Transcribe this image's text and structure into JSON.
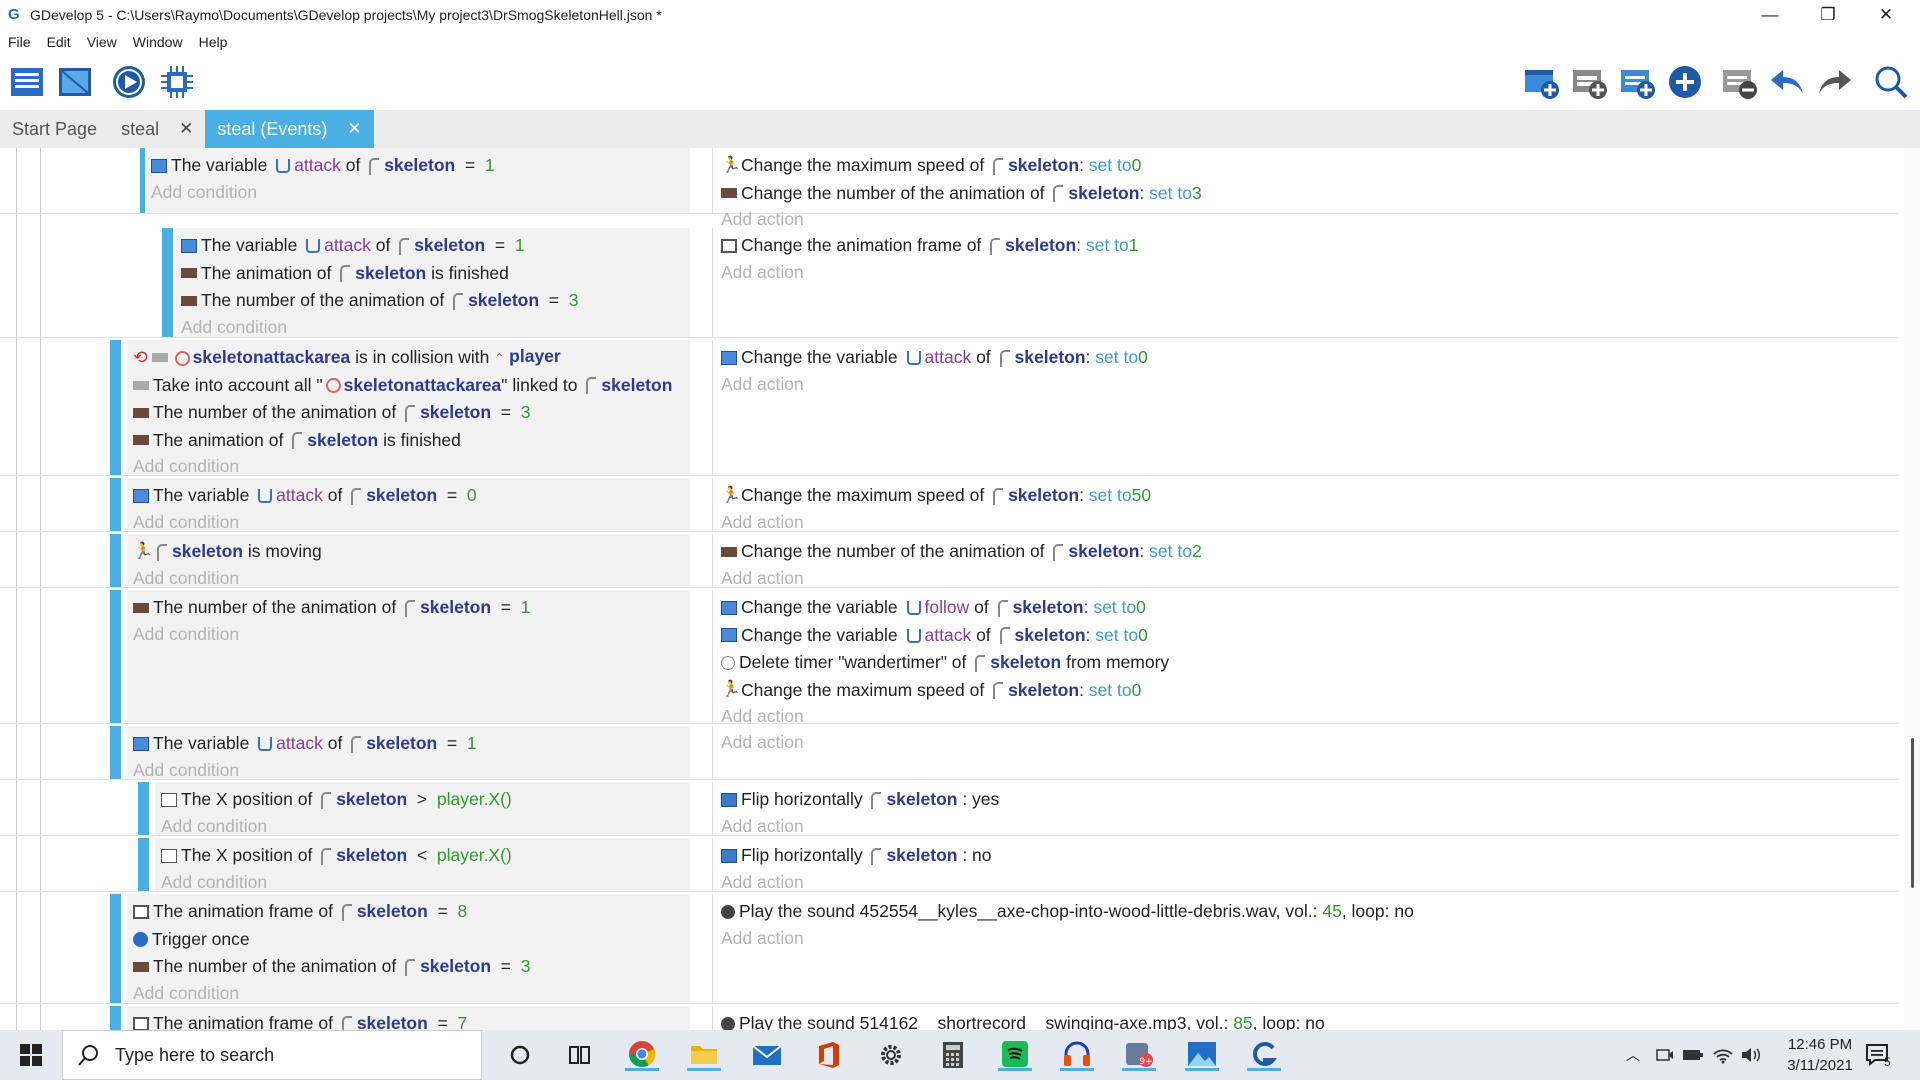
{
  "window": {
    "title": "GDevelop 5 - C:\\Users\\Raymo\\Documents\\GDevelop projects\\My project3\\DrSmogSkeletonHell.json *",
    "minimize": "—",
    "maximize": "❐",
    "close": "✕"
  },
  "menu": [
    "File",
    "Edit",
    "View",
    "Window",
    "Help"
  ],
  "tabs": [
    {
      "label": "Start Page",
      "active": false,
      "closable": false
    },
    {
      "label": "steal",
      "active": false,
      "closable": true
    },
    {
      "label": "steal (Events)",
      "active": true,
      "closable": true
    }
  ],
  "tab_close": "✕",
  "add_condition": "Add condition",
  "add_action": "Add action",
  "events": [
    {
      "conditions": [
        {
          "icon": "variable",
          "parts": [
            [
              "t",
              "The variable "
            ],
            [
              "v",
              "attack"
            ],
            [
              "t",
              " of "
            ],
            [
              "o",
              "skeleton"
            ],
            [
              "t",
              "  =  "
            ],
            [
              "n",
              "1"
            ]
          ]
        }
      ],
      "actions": [
        {
          "icon": "speed",
          "parts": [
            [
              "t",
              "Change the maximum speed of "
            ],
            [
              "o",
              "skeleton"
            ],
            [
              "t",
              ": "
            ],
            [
              "k",
              "set to "
            ],
            [
              "n",
              "0"
            ]
          ]
        },
        {
          "icon": "anim",
          "parts": [
            [
              "t",
              "Change the number of the animation of "
            ],
            [
              "o",
              "skeleton"
            ],
            [
              "t",
              ": "
            ],
            [
              "k",
              "set to "
            ],
            [
              "n",
              "3"
            ]
          ]
        }
      ]
    },
    {
      "conditions": [
        {
          "icon": "variable",
          "parts": [
            [
              "t",
              "The variable "
            ],
            [
              "v",
              "attack"
            ],
            [
              "t",
              " of "
            ],
            [
              "o",
              "skeleton"
            ],
            [
              "t",
              "  =  "
            ],
            [
              "n",
              "1"
            ]
          ]
        },
        {
          "icon": "anim",
          "parts": [
            [
              "t",
              "The animation of "
            ],
            [
              "o",
              "skeleton"
            ],
            [
              "t",
              " is finished"
            ]
          ]
        },
        {
          "icon": "anim",
          "parts": [
            [
              "t",
              "The number of the animation of "
            ],
            [
              "o",
              "skeleton"
            ],
            [
              "t",
              "  =  "
            ],
            [
              "n",
              "3"
            ]
          ]
        }
      ],
      "actions": [
        {
          "icon": "frame",
          "parts": [
            [
              "t",
              "Change the animation frame of "
            ],
            [
              "o",
              "skeleton"
            ],
            [
              "t",
              ": "
            ],
            [
              "k",
              "set to "
            ],
            [
              "n",
              "1"
            ]
          ]
        }
      ]
    },
    {
      "conditions": [
        {
          "icon": "collision",
          "parts": [
            [
              "c",
              "skeletonattackarea"
            ],
            [
              "t",
              " is in collision with "
            ],
            [
              "p",
              "player"
            ]
          ]
        },
        {
          "icon": "link",
          "parts": [
            [
              "t",
              "Take into account all \""
            ],
            [
              "c",
              "skeletonattackarea"
            ],
            [
              "t",
              "\" linked to "
            ],
            [
              "o",
              "skeleton"
            ]
          ]
        },
        {
          "icon": "anim",
          "parts": [
            [
              "t",
              "The number of the animation of "
            ],
            [
              "o",
              "skeleton"
            ],
            [
              "t",
              "  =  "
            ],
            [
              "n",
              "3"
            ]
          ]
        },
        {
          "icon": "anim",
          "parts": [
            [
              "t",
              "The animation of "
            ],
            [
              "o",
              "skeleton"
            ],
            [
              "t",
              " is finished"
            ]
          ]
        }
      ],
      "actions": [
        {
          "icon": "variable",
          "parts": [
            [
              "t",
              "Change the variable "
            ],
            [
              "v",
              "attack"
            ],
            [
              "t",
              " of "
            ],
            [
              "o",
              "skeleton"
            ],
            [
              "t",
              ": "
            ],
            [
              "k",
              "set to "
            ],
            [
              "n",
              "0"
            ]
          ]
        }
      ]
    },
    {
      "conditions": [
        {
          "icon": "variable",
          "parts": [
            [
              "t",
              "The variable "
            ],
            [
              "v",
              "attack"
            ],
            [
              "t",
              " of "
            ],
            [
              "o",
              "skeleton"
            ],
            [
              "t",
              "  =  "
            ],
            [
              "n",
              "0"
            ]
          ]
        }
      ],
      "actions": [
        {
          "icon": "speed",
          "parts": [
            [
              "t",
              "Change the maximum speed of "
            ],
            [
              "o",
              "skeleton"
            ],
            [
              "t",
              ": "
            ],
            [
              "k",
              "set to "
            ],
            [
              "n",
              "50"
            ]
          ]
        }
      ]
    },
    {
      "conditions": [
        {
          "icon": "speed",
          "parts": [
            [
              "o",
              "skeleton"
            ],
            [
              "t",
              " is moving"
            ]
          ]
        }
      ],
      "actions": [
        {
          "icon": "anim",
          "parts": [
            [
              "t",
              "Change the number of the animation of "
            ],
            [
              "o",
              "skeleton"
            ],
            [
              "t",
              ": "
            ],
            [
              "k",
              "set to "
            ],
            [
              "n",
              "2"
            ]
          ]
        }
      ]
    },
    {
      "conditions": [
        {
          "icon": "anim",
          "parts": [
            [
              "t",
              "The number of the animation of "
            ],
            [
              "o",
              "skeleton"
            ],
            [
              "t",
              "  =  "
            ],
            [
              "n",
              "1"
            ]
          ]
        }
      ],
      "actions": [
        {
          "icon": "variable",
          "parts": [
            [
              "t",
              "Change the variable "
            ],
            [
              "v",
              "follow"
            ],
            [
              "t",
              " of "
            ],
            [
              "o",
              "skeleton"
            ],
            [
              "t",
              ": "
            ],
            [
              "k",
              "set to "
            ],
            [
              "n",
              "0"
            ]
          ]
        },
        {
          "icon": "variable",
          "parts": [
            [
              "t",
              "Change the variable "
            ],
            [
              "v",
              "attack"
            ],
            [
              "t",
              " of "
            ],
            [
              "o",
              "skeleton"
            ],
            [
              "t",
              ": "
            ],
            [
              "k",
              "set to "
            ],
            [
              "n",
              "0"
            ]
          ]
        },
        {
          "icon": "timer",
          "parts": [
            [
              "t",
              "Delete timer \"wandertimer\" of "
            ],
            [
              "o",
              "skeleton"
            ],
            [
              "t",
              " from memory"
            ]
          ]
        },
        {
          "icon": "speed",
          "parts": [
            [
              "t",
              "Change the maximum speed of "
            ],
            [
              "o",
              "skeleton"
            ],
            [
              "t",
              ": "
            ],
            [
              "k",
              "set to "
            ],
            [
              "n",
              "0"
            ]
          ]
        }
      ]
    },
    {
      "conditions": [
        {
          "icon": "variable",
          "parts": [
            [
              "t",
              "The variable "
            ],
            [
              "v",
              "attack"
            ],
            [
              "t",
              " of "
            ],
            [
              "o",
              "skeleton"
            ],
            [
              "t",
              "  =  "
            ],
            [
              "n",
              "1"
            ]
          ]
        }
      ],
      "actions": []
    },
    {
      "conditions": [
        {
          "icon": "position",
          "parts": [
            [
              "t",
              "The X position of "
            ],
            [
              "o",
              "skeleton"
            ],
            [
              "t",
              "  >  "
            ],
            [
              "n",
              "player.X()"
            ]
          ]
        }
      ],
      "actions": [
        {
          "icon": "flip",
          "parts": [
            [
              "t",
              "Flip horizontally "
            ],
            [
              "o",
              "skeleton"
            ],
            [
              "t",
              " : yes"
            ]
          ]
        }
      ]
    },
    {
      "conditions": [
        {
          "icon": "position",
          "parts": [
            [
              "t",
              "The X position of "
            ],
            [
              "o",
              "skeleton"
            ],
            [
              "t",
              "  <  "
            ],
            [
              "n",
              "player.X()"
            ]
          ]
        }
      ],
      "actions": [
        {
          "icon": "flip",
          "parts": [
            [
              "t",
              "Flip horizontally "
            ],
            [
              "o",
              "skeleton"
            ],
            [
              "t",
              " : no"
            ]
          ]
        }
      ]
    },
    {
      "conditions": [
        {
          "icon": "frame",
          "parts": [
            [
              "t",
              "The animation frame of "
            ],
            [
              "o",
              "skeleton"
            ],
            [
              "t",
              "  =  "
            ],
            [
              "n",
              "8"
            ]
          ]
        },
        {
          "icon": "trigger",
          "parts": [
            [
              "t",
              "Trigger once"
            ]
          ]
        },
        {
          "icon": "anim",
          "parts": [
            [
              "t",
              "The number of the animation of "
            ],
            [
              "o",
              "skeleton"
            ],
            [
              "t",
              "  =  "
            ],
            [
              "n",
              "3"
            ]
          ]
        }
      ],
      "actions": [
        {
          "icon": "sound",
          "parts": [
            [
              "t",
              "Play the sound 452554__kyles__axe-chop-into-wood-little-debris.wav, vol.: "
            ],
            [
              "n",
              "45"
            ],
            [
              "t",
              ", loop: no"
            ]
          ]
        }
      ]
    },
    {
      "conditions": [
        {
          "icon": "frame",
          "parts": [
            [
              "t",
              "The animation frame of "
            ],
            [
              "o",
              "skeleton"
            ],
            [
              "t",
              "  =  "
            ],
            [
              "n",
              "7"
            ]
          ]
        }
      ],
      "actions": [
        {
          "icon": "sound",
          "parts": [
            [
              "t",
              "Play the sound 514162__shortrecord__swinging-axe.mp3, vol.: "
            ],
            [
              "n",
              "85"
            ],
            [
              "t",
              ", loop: no"
            ]
          ]
        }
      ]
    }
  ],
  "taskbar": {
    "search_placeholder": "Type here to search",
    "time": "12:46 PM",
    "date": "3/11/2021",
    "notification_count": "5"
  },
  "colors": {
    "accent": "#4ab0e4",
    "object": "#2a3a95",
    "variable": "#8a3aa0",
    "value": "#2e9a2a",
    "keyword": "#3a9ad8"
  }
}
